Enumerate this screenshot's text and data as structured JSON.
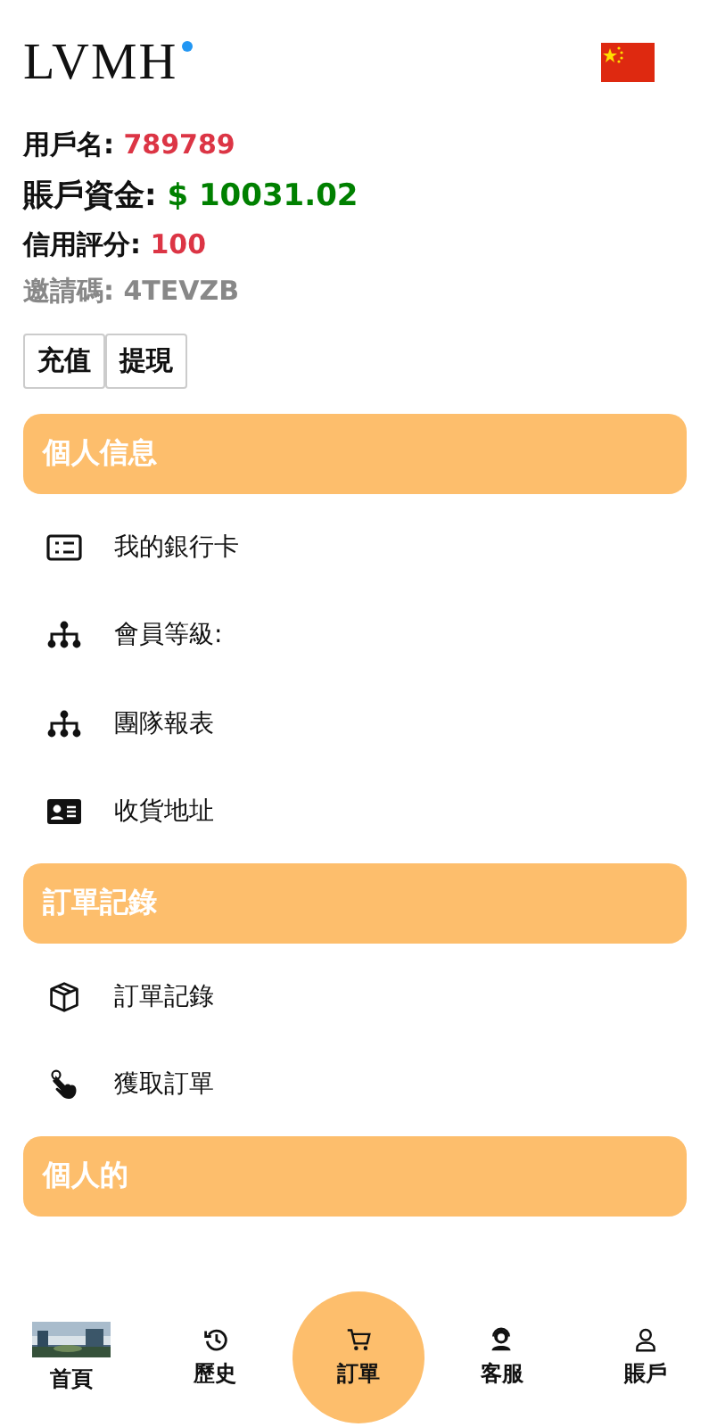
{
  "header": {
    "logo": "LVMH"
  },
  "info": [
    {
      "label": "用戶名:",
      "value": "789789",
      "color": "#dc3545",
      "kind": "plain"
    },
    {
      "label": "賬戶資金:",
      "value": "$ 10031.02",
      "color": "#008000",
      "kind": "plain"
    },
    {
      "label": "信用評分:",
      "value": "100",
      "color": "#dc3545",
      "kind": "plain"
    },
    {
      "label": "邀請碼:",
      "value": "4TEVZB",
      "color": "#888888",
      "kind": "muted"
    }
  ],
  "actions": [
    "充值",
    "提現"
  ],
  "sections": [
    {
      "title": "個人信息",
      "items": [
        {
          "label": "我的銀行卡",
          "kind": "card"
        },
        {
          "label": "會員等級:",
          "kind": "tree"
        },
        {
          "label": "團隊報表",
          "kind": "tree"
        },
        {
          "label": "收貨地址",
          "kind": "idcard"
        }
      ]
    },
    {
      "title": "訂單記錄",
      "items": [
        {
          "label": "訂單記錄",
          "kind": "box"
        },
        {
          "label": "獲取訂單",
          "kind": "hand"
        }
      ]
    },
    {
      "title": "個人的"
    }
  ],
  "nav": [
    {
      "label": "首頁",
      "kind": "picture",
      "selected": false
    },
    {
      "label": "歷史",
      "kind": "history",
      "selected": false
    },
    {
      "label": "訂單",
      "kind": "cart",
      "selected": true
    },
    {
      "label": "客服",
      "kind": "support",
      "selected": false
    },
    {
      "label": "賬戶",
      "kind": "user",
      "selected": false
    }
  ]
}
